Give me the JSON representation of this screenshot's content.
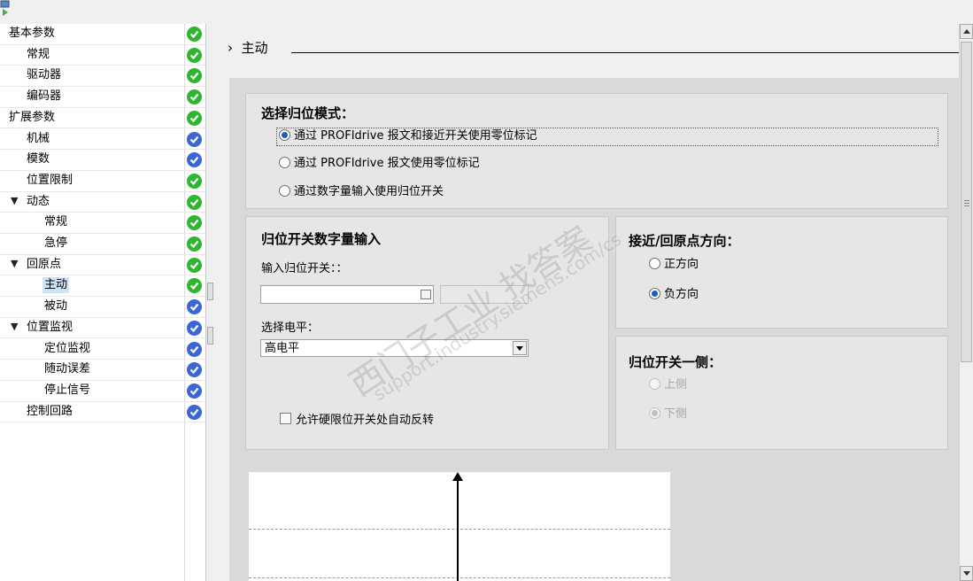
{
  "tree": {
    "items": [
      {
        "label": "基本参数",
        "level": 0,
        "arrow": "",
        "status": "green"
      },
      {
        "label": "常规",
        "level": 1,
        "arrow": "",
        "status": "green"
      },
      {
        "label": "驱动器",
        "level": 1,
        "arrow": "",
        "status": "green"
      },
      {
        "label": "编码器",
        "level": 1,
        "arrow": "",
        "status": "green"
      },
      {
        "label": "扩展参数",
        "level": 0,
        "arrow": "",
        "status": "green"
      },
      {
        "label": "机械",
        "level": 1,
        "arrow": "",
        "status": "blue"
      },
      {
        "label": "模数",
        "level": 1,
        "arrow": "",
        "status": "blue"
      },
      {
        "label": "位置限制",
        "level": 1,
        "arrow": "",
        "status": "green"
      },
      {
        "label": "动态",
        "level": 1,
        "arrow": "▼",
        "status": "green"
      },
      {
        "label": "常规",
        "level": 2,
        "arrow": "",
        "status": "green"
      },
      {
        "label": "急停",
        "level": 2,
        "arrow": "",
        "status": "green"
      },
      {
        "label": "回原点",
        "level": 1,
        "arrow": "▼",
        "status": "green"
      },
      {
        "label": "主动",
        "level": 2,
        "arrow": "",
        "status": "green",
        "selected": true
      },
      {
        "label": "被动",
        "level": 2,
        "arrow": "",
        "status": "blue"
      },
      {
        "label": "位置监视",
        "level": 1,
        "arrow": "▼",
        "status": "blue"
      },
      {
        "label": "定位监视",
        "level": 2,
        "arrow": "",
        "status": "blue"
      },
      {
        "label": "随动误差",
        "level": 2,
        "arrow": "",
        "status": "blue"
      },
      {
        "label": "停止信号",
        "level": 2,
        "arrow": "",
        "status": "blue"
      },
      {
        "label": "控制回路",
        "level": 1,
        "arrow": "",
        "status": "blue"
      }
    ],
    "status_colors": {
      "green": "#2fb62f",
      "blue": "#3a66d6"
    }
  },
  "main": {
    "section_arrow": "›",
    "section_title": "主动",
    "mode_group": {
      "title": "选择归位模式：",
      "options": [
        "通过 PROFIdrive 报文和接近开关使用零位标记",
        "通过 PROFIdrive 报文使用零位标记",
        "通过数字量输入使用归位开关"
      ],
      "selected_index": 0
    },
    "switch_group": {
      "title": "归位开关数字量输入",
      "input_label": "输入归位开关：：",
      "input_value": "",
      "level_label": "选择电平：",
      "level_value": "高电平",
      "auto_reverse_label": "允许硬限位开关处自动反转",
      "auto_reverse_checked": false
    },
    "direction_group": {
      "title": "接近/回原点方向：",
      "options": [
        "正方向",
        "负方向"
      ],
      "selected_index": 1
    },
    "side_group": {
      "title": "归位开关一侧：",
      "options": [
        "上侧",
        "下侧"
      ],
      "selected_index": 1,
      "disabled": true
    }
  },
  "watermark": {
    "line1": "西门子工业 找答案",
    "line2": "support.industry.siemens.com/cs"
  },
  "icons": {
    "app": "app-icon",
    "status_ok": "check-icon",
    "browse": "browse-icon",
    "dropdown": "chevron-down-icon"
  }
}
